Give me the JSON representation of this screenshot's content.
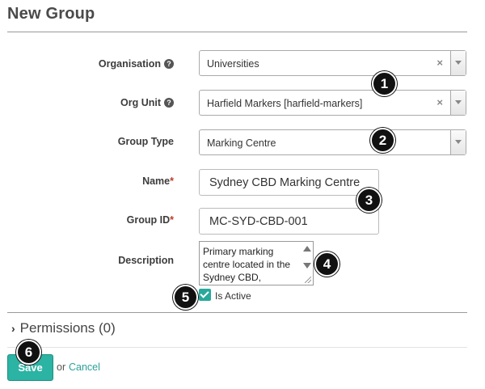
{
  "page": {
    "title": "New Group"
  },
  "form": {
    "organisation": {
      "label": "Organisation",
      "value": "Universities",
      "clear": "×"
    },
    "org_unit": {
      "label": "Org Unit",
      "value": "Harfield Markers [harfield-markers]",
      "clear": "×"
    },
    "group_type": {
      "label": "Group Type",
      "value": "Marking Centre"
    },
    "name": {
      "label": "Name",
      "required": "*",
      "value": "Sydney CBD Marking Centre"
    },
    "group_id": {
      "label": "Group ID",
      "required": "*",
      "value": "MC-SYD-CBD-001"
    },
    "description": {
      "label": "Description",
      "value": "Primary marking centre located in the Sydney CBD,"
    },
    "is_active": {
      "label": "Is Active",
      "checked": true
    },
    "help_glyph": "?"
  },
  "permissions": {
    "label": "Permissions (0)",
    "chevron": "›"
  },
  "actions": {
    "save_label": "Save",
    "or_text": "or",
    "cancel_label": "Cancel"
  },
  "callouts": [
    "1",
    "2",
    "3",
    "4",
    "5",
    "6"
  ],
  "colors": {
    "accent": "#2bb3a3",
    "required": "#c0392b",
    "badge": "#111111"
  }
}
